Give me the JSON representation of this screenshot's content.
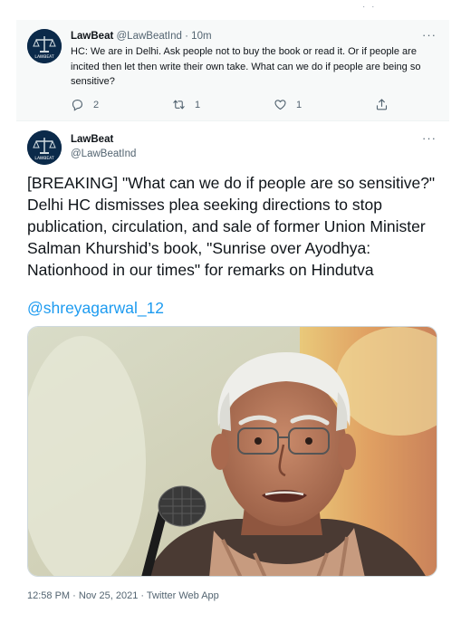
{
  "reply_tweet": {
    "author_name": "LawBeat",
    "author_handle": "@LawBeatInd",
    "separator": "·",
    "time": "10m",
    "text": "HC: We are in Delhi. Ask people not to buy the book or read it. Or if people are incited then let then write their own take. What can we do if people are being so sensitive?",
    "reply_count": "2",
    "retweet_count": "1",
    "like_count": "1",
    "avatar_logo_text": "LAWBEAT"
  },
  "main_tweet": {
    "author_name": "LawBeat",
    "author_handle": "@LawBeatInd",
    "text": "[BREAKING] \"What can we do if people are so sensitive?\" Delhi HC dismisses plea seeking directions to stop publication, circulation, and sale of former Union Minister Salman Khurshid’s book, \"Sunrise over Ayodhya: Nationhood in our times\" for remarks on Hindutva",
    "mention": "@shreyagarwal_12",
    "time": "12:58 PM",
    "date": "Nov 25, 2021",
    "source": "Twitter Web App",
    "meta_separator": " · "
  },
  "icons": {
    "reply": "reply-icon",
    "retweet": "retweet-icon",
    "like": "heart-icon",
    "share": "share-icon",
    "more": "more-icon"
  },
  "colors": {
    "link": "#1d9bf0",
    "secondary_text": "#536471",
    "reply_bg": "#f7f9f9",
    "avatar_bg": "#0b2a4a"
  }
}
